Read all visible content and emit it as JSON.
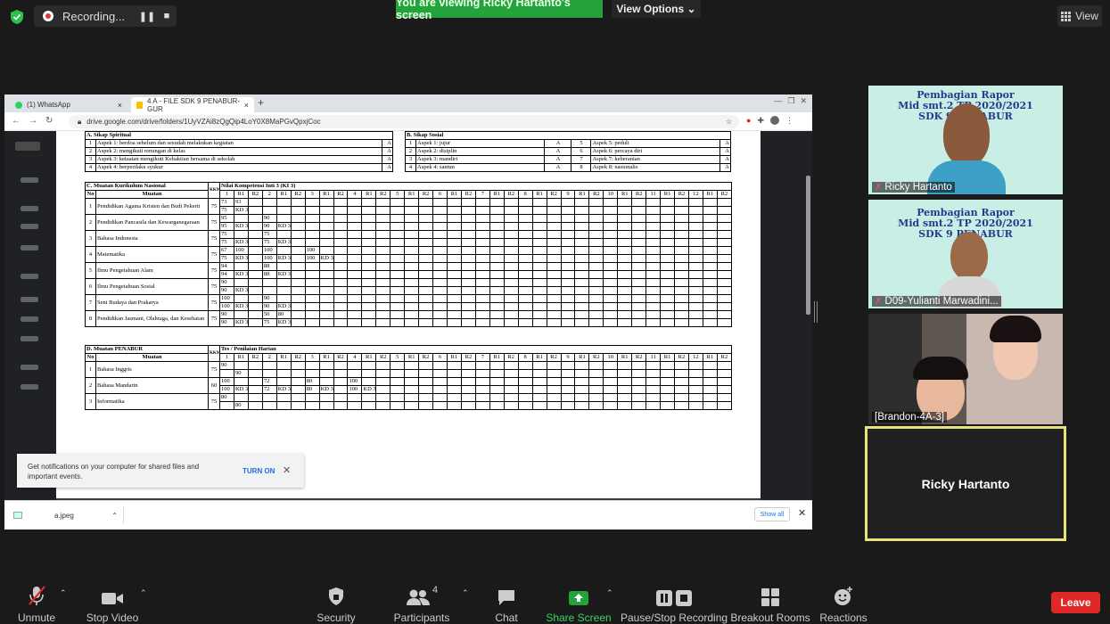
{
  "top": {
    "recording_label": "Recording...",
    "viewing_banner": "You are viewing Ricky Hartanto's screen",
    "view_options": "View Options",
    "view_button": "View"
  },
  "browser": {
    "tab1": "(1) WhatsApp",
    "tab2": "4 A - FILE SDK 9 PENABUR- GUR",
    "url": "drive.google.com/drive/folders/1UyVZAi8zQgQip4LoY0X8MaPGvQpxjCoc",
    "download_file": "a.jpeg",
    "show_all": "Show all"
  },
  "notification": {
    "text": "Get notifications on your computer for shared files and important events.",
    "action": "TURN ON"
  },
  "report": {
    "a_title": "A. Sikap Spiritual",
    "a_rows": [
      {
        "no": "1",
        "aspek": "Aspek 1: berdoa sebelum dan sesudah melakukan kegiatan",
        "nilai": "A"
      },
      {
        "no": "2",
        "aspek": "Aspek 2: mengikuti renungan di kelas",
        "nilai": "A"
      },
      {
        "no": "3",
        "aspek": "Aspek 3: ketaatan mengikuti Kebaktian bersama di sekolah",
        "nilai": "A"
      },
      {
        "no": "4",
        "aspek": "Aspek 4: berperilaku syukur",
        "nilai": "A"
      }
    ],
    "b_title": "B. Sikap Sosial",
    "b_rows": [
      {
        "no1": "1",
        "a1": "Aspek 1: jujur",
        "n1": "A",
        "no2": "5",
        "a2": "Aspek 5: peduli",
        "n2": "A"
      },
      {
        "no1": "2",
        "a1": "Aspek 2: disiplin",
        "n1": "A",
        "no2": "6",
        "a2": "Aspek 6: percaya diri",
        "n2": "A"
      },
      {
        "no1": "3",
        "a1": "Aspek 3: mandiri",
        "n1": "A",
        "no2": "7",
        "a2": "Aspek 7: keberanian",
        "n2": "A"
      },
      {
        "no1": "4",
        "a1": "Aspek 4: santun",
        "n1": "A",
        "no2": "8",
        "a2": "Aspek 8: nasionalis",
        "n2": "A"
      }
    ],
    "c_title": "C. Muatan Kurikulum Nasional",
    "c_header": "Nilai Kompetensi Inti 3 (KI 3)",
    "kkm": "KKM",
    "col_no": "No",
    "col_muatan": "Muatan",
    "cols": [
      "1",
      "R1",
      "R2",
      "2",
      "R1",
      "R2",
      "3",
      "R1",
      "R2",
      "4",
      "R1",
      "R2",
      "5",
      "R1",
      "R2",
      "6",
      "R1",
      "R2",
      "7",
      "R1",
      "R2",
      "8",
      "R1",
      "R2",
      "9",
      "R1",
      "R2",
      "10",
      "R1",
      "R2",
      "11",
      "R1",
      "R2",
      "12",
      "R1",
      "R2"
    ],
    "c_rows": [
      {
        "no": "1",
        "muatan": "Pendidikan Agama Kristen dan Budi Pekerti",
        "kkm": "75",
        "r1": [
          "73",
          "93"
        ],
        "r2": [
          "75",
          "KD 3.3"
        ]
      },
      {
        "no": "2",
        "muatan": "Pendidikan Pancasila dan Kewarganegaraan",
        "kkm": "75",
        "r1": [
          "95",
          "",
          "",
          "90"
        ],
        "r2": [
          "95",
          "KD 3.3",
          "",
          "90",
          "KD 3.4"
        ]
      },
      {
        "no": "3",
        "muatan": "Bahasa Indonesia",
        "kkm": "75",
        "r1": [
          "75",
          "",
          "",
          "75"
        ],
        "r2": [
          "75",
          "KD 3.3",
          "",
          "75",
          "KD 3.6"
        ]
      },
      {
        "no": "4",
        "muatan": "Matematika",
        "kkm": "75",
        "r1": [
          "67",
          "100",
          "",
          "100",
          "",
          "",
          "100"
        ],
        "r2": [
          "75",
          "KD 3.8",
          "",
          "100",
          "KD 3.10",
          "",
          "100",
          "KD 3.9"
        ]
      },
      {
        "no": "5",
        "muatan": "Ilmu Pengetahuan Alam",
        "kkm": "75",
        "r1": [
          "94",
          "",
          "",
          "88"
        ],
        "r2": [
          "94",
          "KD 3.4",
          "",
          "88",
          "KD 3.5"
        ]
      },
      {
        "no": "6",
        "muatan": "Ilmu Pengetahuan Sosial",
        "kkm": "75",
        "r1": [
          "90"
        ],
        "r2": [
          "90",
          "KD 3.2"
        ]
      },
      {
        "no": "7",
        "muatan": "Seni Budaya dan Prakarya",
        "kkm": "75",
        "r1": [
          "100",
          "",
          "",
          "90"
        ],
        "r2": [
          "100",
          "KD 3.1",
          "",
          "90",
          "KD 3.4"
        ]
      },
      {
        "no": "8",
        "muatan": "Pendidikan Jasmani, Olahraga, dan Kesehatan",
        "kkm": "75",
        "r1": [
          "90",
          "",
          "",
          "50",
          "80"
        ],
        "r2": [
          "90",
          "KD 3.3",
          "",
          "75",
          "KD 3.9"
        ]
      }
    ],
    "d_title": "D. Muatan PENABUR",
    "d_header": "Tes / Penilaian Harian",
    "d_rows": [
      {
        "no": "1",
        "muatan": "Bahasa Inggris",
        "kkm": "75",
        "r1": [
          "90"
        ],
        "r2": [
          "",
          "90"
        ]
      },
      {
        "no": "2",
        "muatan": "Bahasa Mandarin",
        "kkm": "60",
        "r1": [
          "100",
          "",
          "",
          "72",
          "",
          "",
          "80",
          "",
          "",
          "100"
        ],
        "r2": [
          "100",
          "KD 3.1",
          "",
          "72",
          "KD 3.2",
          "",
          "80",
          "KD 3.3",
          "",
          "100",
          "KD 3.4"
        ]
      },
      {
        "no": "3",
        "muatan": "Informatika",
        "kkm": "75",
        "r1": [
          "80"
        ],
        "r2": [
          "",
          "80"
        ]
      }
    ]
  },
  "gallery": {
    "banner_line1": "Pembagian Rapor",
    "banner_line2": "Mid smt.2 TP 2020/2021",
    "banner_line3": "SDK 9 PENABUR",
    "t1_name": "Ricky Hartanto",
    "t2_name": "D09-Yulianti Marwadini...",
    "t3_name": "[Brandon-4A-3]",
    "t4_name": "Ricky Hartanto"
  },
  "toolbar": {
    "unmute": "Unmute",
    "stop_video": "Stop Video",
    "security": "Security",
    "participants": "Participants",
    "participants_count": "4",
    "chat": "Chat",
    "share_screen": "Share Screen",
    "pause_recording": "Pause/Stop Recording",
    "breakout": "Breakout Rooms",
    "reactions": "Reactions",
    "leave": "Leave"
  },
  "colors": {
    "share_green": "#23a33a",
    "leave_red": "#e02828",
    "active_speaker": "#e8e27a"
  }
}
